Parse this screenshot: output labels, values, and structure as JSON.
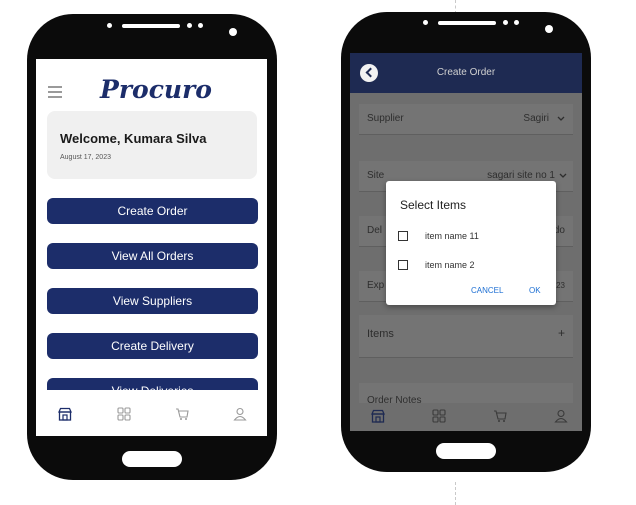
{
  "phone_home": {
    "app_title": "Procuro",
    "welcome": {
      "greeting": "Welcome, Kumara Silva",
      "date": "August 17, 2023"
    },
    "buttons": [
      "Create Order",
      "View All Orders",
      "View Suppliers",
      "Create Delivery",
      "View Deliveries"
    ],
    "nav_icons": [
      "store-icon",
      "grid-icon",
      "cart-icon",
      "user-icon"
    ]
  },
  "phone_create_order": {
    "header_title": "Create Order",
    "fields": {
      "supplier": {
        "label": "Supplier",
        "value": "Sagiri"
      },
      "site": {
        "label": "Site",
        "value": "sagari site no 1"
      },
      "delivery": {
        "label": "Del",
        "value": "do"
      },
      "expected": {
        "label": "Exp",
        "value": "023"
      },
      "items": {
        "label": "Items",
        "action": "+"
      },
      "order_notes": {
        "label": "Order Notes"
      }
    },
    "dialog": {
      "title": "Select Items",
      "items": [
        {
          "label": "item name 11",
          "checked": false
        },
        {
          "label": "item name 2",
          "checked": false
        }
      ],
      "cancel_label": "CANCEL",
      "ok_label": "OK"
    },
    "nav_icons": [
      "store-icon",
      "grid-icon",
      "cart-icon",
      "user-icon"
    ]
  },
  "colors": {
    "primary": "#1c2d6a",
    "appbar": "#1e2a52",
    "dialog_action": "#1d6fd3",
    "scrim": "#6e6e6e"
  }
}
